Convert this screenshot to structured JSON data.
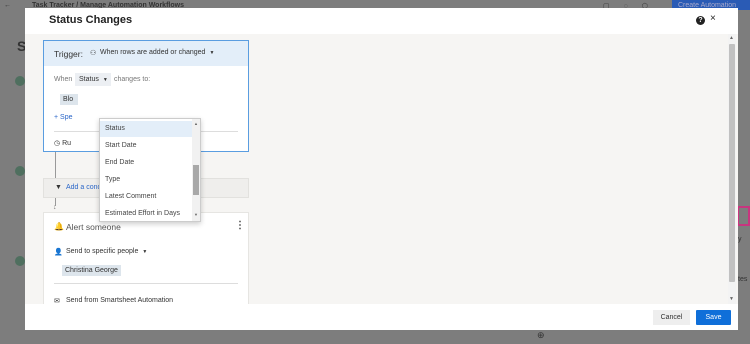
{
  "background": {
    "back_glyph": "←",
    "breadcrumb": "Task Tracker  /  Manage Automation Workflows",
    "header_button": "Create Automation",
    "left_initial": "S",
    "right_text_1": "y",
    "right_text_2": "tes"
  },
  "modal": {
    "title": "Status Changes",
    "help_glyph": "?",
    "close_glyph": "×"
  },
  "trigger": {
    "label": "Trigger:",
    "mode": "When rows are added or changed",
    "when_label": "When",
    "field": "Status",
    "changes_label": "changes to:",
    "value_chip": "Blo",
    "spec_link": "+ Spe",
    "run_text": "Ru"
  },
  "dropdown": {
    "items": [
      {
        "label": "Status",
        "selected": true
      },
      {
        "label": "Start Date",
        "selected": false
      },
      {
        "label": "End Date",
        "selected": false
      },
      {
        "label": "Type",
        "selected": false
      },
      {
        "label": "Latest Comment",
        "selected": false
      },
      {
        "label": "Estimated Effort in Days",
        "selected": false
      }
    ]
  },
  "filter": {
    "link": "Add a condition to filter rows"
  },
  "action": {
    "title": "Alert someone",
    "send_to": "Send to specific people",
    "recipient": "Christina George",
    "send_from": "Send from Smartsheet Automation"
  },
  "footer": {
    "cancel": "Cancel",
    "save": "Save"
  },
  "colors": {
    "accent": "#0f6fd9",
    "trigger_border": "#5a9de0",
    "trigger_head_bg": "#e3eef9"
  }
}
